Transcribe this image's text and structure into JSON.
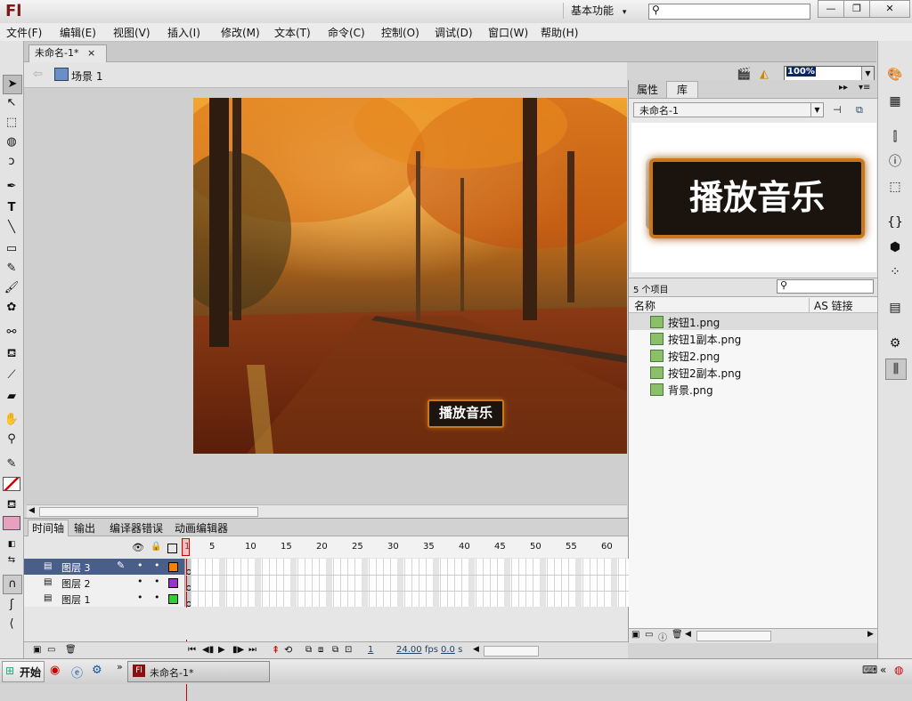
{
  "app": {
    "logo": "Fl",
    "workspace": "基本功能",
    "workspace_arrow": "▾"
  },
  "window_controls": {
    "minimize": "—",
    "restore": "❐",
    "close": "✕"
  },
  "menu": [
    "文件(F)",
    "编辑(E)",
    "视图(V)",
    "插入(I)",
    "修改(M)",
    "文本(T)",
    "命令(C)",
    "控制(O)",
    "调试(D)",
    "窗口(W)",
    "帮助(H)"
  ],
  "document": {
    "tab_title": "未命名-1*",
    "tab_close": "×",
    "scene": "场景 1",
    "zoom": "100%"
  },
  "stage": {
    "button_label": "播放音乐"
  },
  "library": {
    "tabs": [
      "属性",
      "库"
    ],
    "active_tab": "库",
    "doc_select": "未命名-1",
    "preview_label": "播放音乐",
    "item_count": "5 个项目",
    "col_name": "名称",
    "col_link": "AS 链接",
    "items": [
      "按钮1.png",
      "按钮1副本.png",
      "按钮2.png",
      "按钮2副本.png",
      "背景.png"
    ]
  },
  "timeline": {
    "tabs": [
      "时间轴",
      "输出",
      "编译器错误",
      "动画编辑器"
    ],
    "frame_numbers": [
      "1",
      "5",
      "10",
      "15",
      "20",
      "25",
      "30",
      "35",
      "40",
      "45",
      "50",
      "55",
      "60"
    ],
    "layers": [
      {
        "name": "图层 3",
        "color": "#ff7f00",
        "selected": true
      },
      {
        "name": "图层 2",
        "color": "#9933cc",
        "selected": false
      },
      {
        "name": "图层 1",
        "color": "#33cc33",
        "selected": false
      }
    ],
    "status": {
      "frame": "1",
      "fps": "24.00",
      "fps_unit": "fps",
      "time": "0.0",
      "time_unit": "s"
    }
  },
  "taskbar": {
    "start": "开始",
    "task": "未命名-1*",
    "more": "»"
  },
  "colors": {
    "accent_red": "#cc0000",
    "stage_bg": "#a0521c"
  }
}
